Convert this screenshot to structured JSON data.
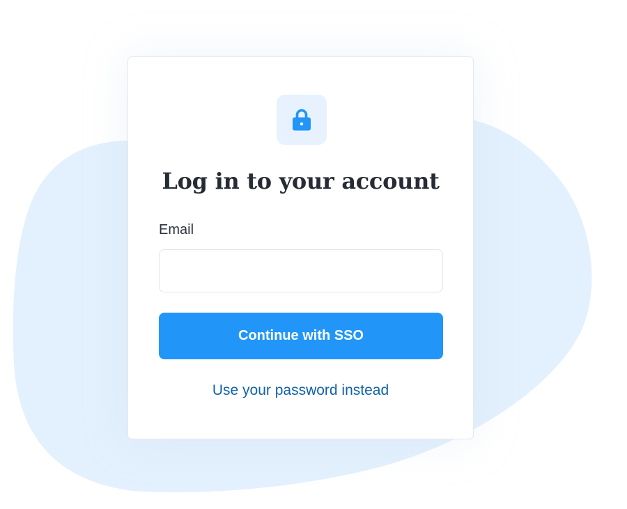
{
  "colors": {
    "background_blob": "#e3f0fd",
    "icon_tile": "#e7f2fe",
    "icon": "#2196f8",
    "primary_button": "#2196f8",
    "link": "#0f62a8",
    "title_text": "#262b35",
    "card_border": "#e6e8ec"
  },
  "login": {
    "icon": "lock-icon",
    "title": "Log in to your account",
    "email_label": "Email",
    "email_value": "",
    "email_placeholder": "",
    "sso_button_label": "Continue with SSO",
    "password_link_label": "Use your password instead"
  }
}
